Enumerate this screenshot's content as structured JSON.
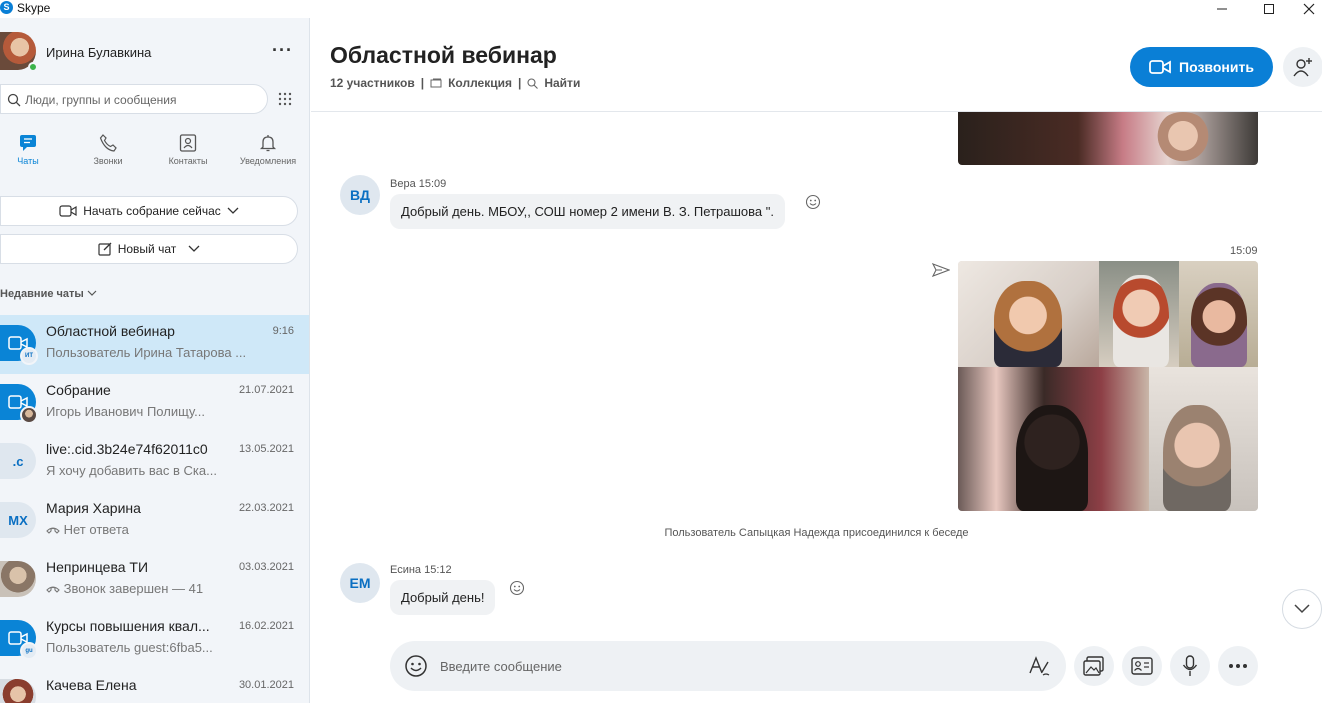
{
  "window": {
    "title": "Skype"
  },
  "profile": {
    "name": "Ирина Булавкина"
  },
  "search": {
    "placeholder": "Люди, группы и сообщения"
  },
  "nav": {
    "tabs": [
      {
        "label": "Чаты",
        "icon": "chat-icon",
        "active": true
      },
      {
        "label": "Звонки",
        "icon": "phone-icon"
      },
      {
        "label": "Контакты",
        "icon": "contacts-icon"
      },
      {
        "label": "Уведомления",
        "icon": "bell-icon"
      }
    ]
  },
  "actions": {
    "meet_now": "Начать собрание сейчас",
    "new_chat": "Новый чат"
  },
  "recent_label": "Недавние чаты",
  "chats": [
    {
      "name": "Областной вебинар",
      "time": "9:16",
      "preview": "Пользователь Ирина Татарова ...",
      "badge": "ИТ"
    },
    {
      "name": "Собрание",
      "time": "21.07.2021",
      "preview": "Игорь Иванович Полищу..."
    },
    {
      "name": "live:.cid.3b24e74f62011c0",
      "time": "13.05.2021",
      "preview": "Я хочу добавить вас в Ска...",
      "initials": ".c"
    },
    {
      "name": "Мария Харина",
      "time": "22.03.2021",
      "preview": "Нет ответа",
      "initials": "МХ"
    },
    {
      "name": "Непринцева ТИ",
      "time": "03.03.2021",
      "preview": "Звонок завершен — 41"
    },
    {
      "name": "Курсы повышения квал...",
      "time": "16.02.2021",
      "preview": "Пользователь guest:6fba5...",
      "badge": "gu"
    },
    {
      "name": "Качева Елена",
      "time": "30.01.2021",
      "preview": ""
    }
  ],
  "conversation": {
    "title": "Областной вебинар",
    "participants": "12 участников",
    "collection": "Коллекция",
    "find": "Найти",
    "call_label": "Позвонить"
  },
  "messages": [
    {
      "initials": "ВД",
      "meta": "Вера 15:09",
      "text": "Добрый день. МБОУ,, СОШ номер 2 имени В. З. Петрашова \"."
    },
    {
      "sent_time": "15:09"
    },
    {
      "system": "Пользователь Сапыцкая Надежда присоединился к беседе"
    },
    {
      "initials": "ЕМ",
      "meta": "Есина 15:12",
      "text": "Добрый день!"
    }
  ],
  "composer": {
    "placeholder": "Введите сообщение"
  },
  "colors": {
    "accent": "#0a7fd6",
    "selected": "#cfe8f8",
    "sidebar": "#f2f5f9",
    "online": "#3bb34a"
  }
}
